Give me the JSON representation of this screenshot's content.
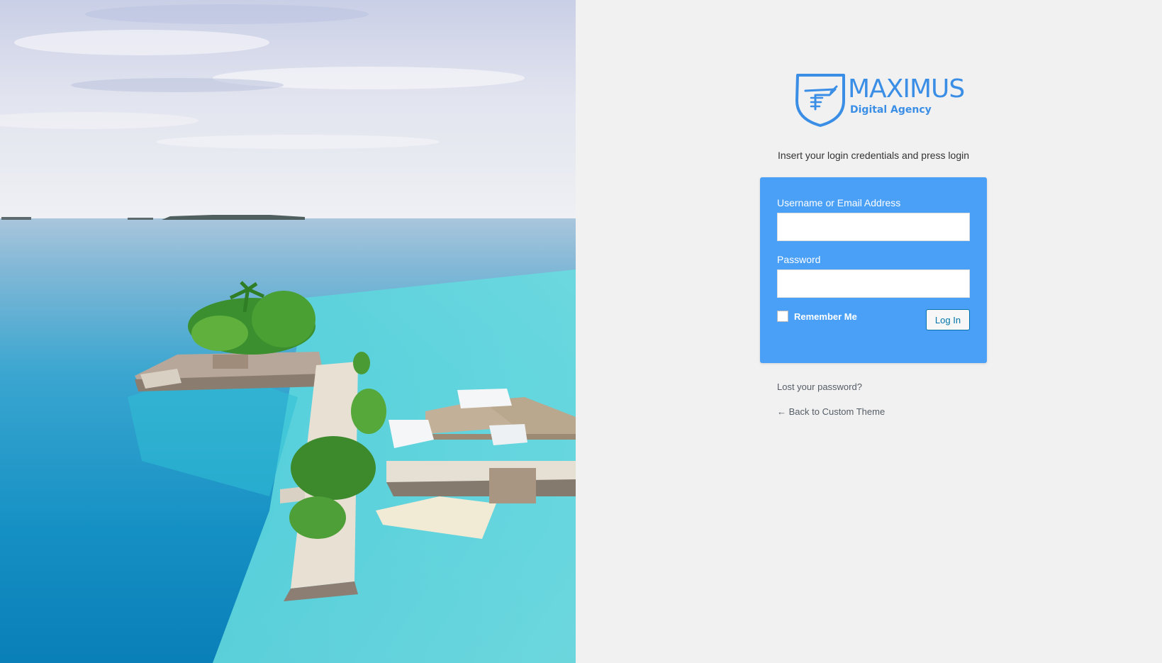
{
  "colors": {
    "accent": "#4aa0f7",
    "brand": "#3a8ee6",
    "background": "#f1f1f1",
    "button_border": "#0073aa",
    "link": "#555d66"
  },
  "photo": {
    "icon": "island-photo"
  },
  "logo": {
    "icon": "shield-icon",
    "brand": "MAXIMUS",
    "tagline": "Digital Agency"
  },
  "instruction": "Insert your login credentials and press login",
  "form": {
    "username_label": "Username or Email Address",
    "username_value": "",
    "password_label": "Password",
    "password_value": "",
    "remember_label": "Remember Me",
    "remember_checked": false,
    "login_button": "Log In"
  },
  "links": {
    "lost_password": "Lost your password?",
    "back_to_site": "← Back to Custom Theme"
  }
}
